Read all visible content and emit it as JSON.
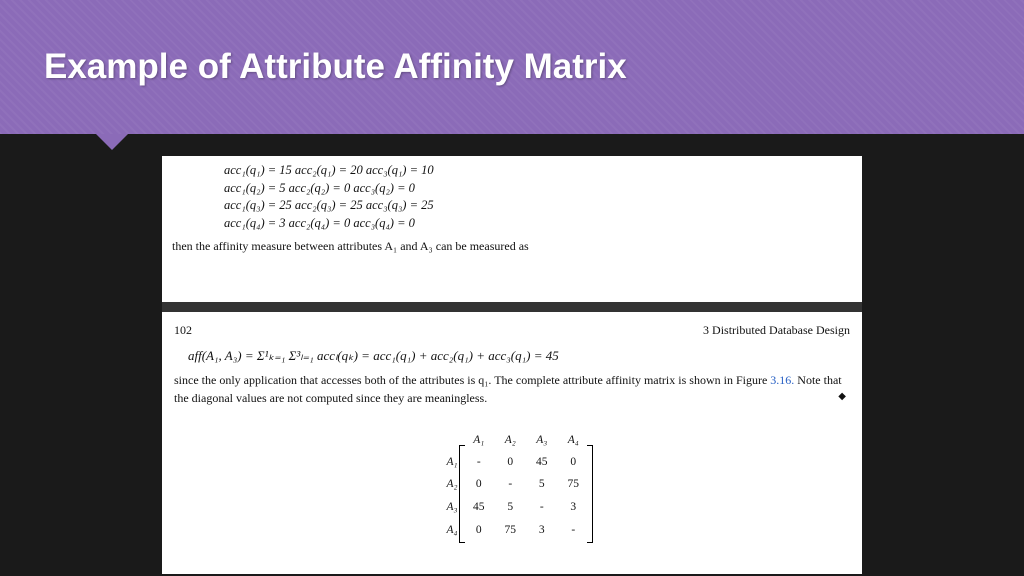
{
  "header": {
    "title": "Example of Attribute Affinity Matrix"
  },
  "page1": {
    "acc": [
      "acc₁(q₁) = 15  acc₂(q₁) = 20  acc₃(q₁) = 10",
      "acc₁(q₂) = 5    acc₂(q₂) = 0    acc₃(q₂) = 0",
      "acc₁(q₃) = 25  acc₂(q₃) = 25  acc₃(q₃) = 25",
      "acc₁(q₄) = 3    acc₂(q₄) = 0    acc₃(q₄) = 0"
    ],
    "aff_text": "then the affinity measure between attributes A₁ and A₃ can be measured as"
  },
  "page2": {
    "pageno": "102",
    "chapter": "3  Distributed Database Design",
    "formula": "aff(A₁, A₃) = Σ¹ₖ₌₁ Σ³ₗ₌₁ accₗ(qₖ) = acc₁(q₁) + acc₂(q₁) + acc₃(q₁) = 45",
    "para1": "since the only application that accesses both of the attributes is q₁. The complete attribute affinity matrix is shown in Figure ",
    "figref": "3.16.",
    "para2": " Note that the diagonal values are not computed since they are meaningless.",
    "matrix": {
      "cols": [
        "A₁",
        "A₂",
        "A₃",
        "A₄"
      ],
      "rows": [
        "A₁",
        "A₂",
        "A₃",
        "A₄"
      ],
      "data": [
        [
          "-",
          "0",
          "45",
          "0"
        ],
        [
          "0",
          "-",
          "5",
          "75"
        ],
        [
          "45",
          "5",
          "-",
          "3"
        ],
        [
          "0",
          "75",
          "3",
          "-"
        ]
      ]
    }
  },
  "chart_data": {
    "type": "table",
    "title": "Attribute Affinity Matrix",
    "categories": [
      "A1",
      "A2",
      "A3",
      "A4"
    ],
    "series": [
      {
        "name": "A1",
        "values": [
          null,
          0,
          45,
          0
        ]
      },
      {
        "name": "A2",
        "values": [
          0,
          null,
          5,
          75
        ]
      },
      {
        "name": "A3",
        "values": [
          45,
          5,
          null,
          3
        ]
      },
      {
        "name": "A4",
        "values": [
          0,
          75,
          3,
          null
        ]
      }
    ],
    "note": "diagonal values not computed (meaningless)"
  }
}
